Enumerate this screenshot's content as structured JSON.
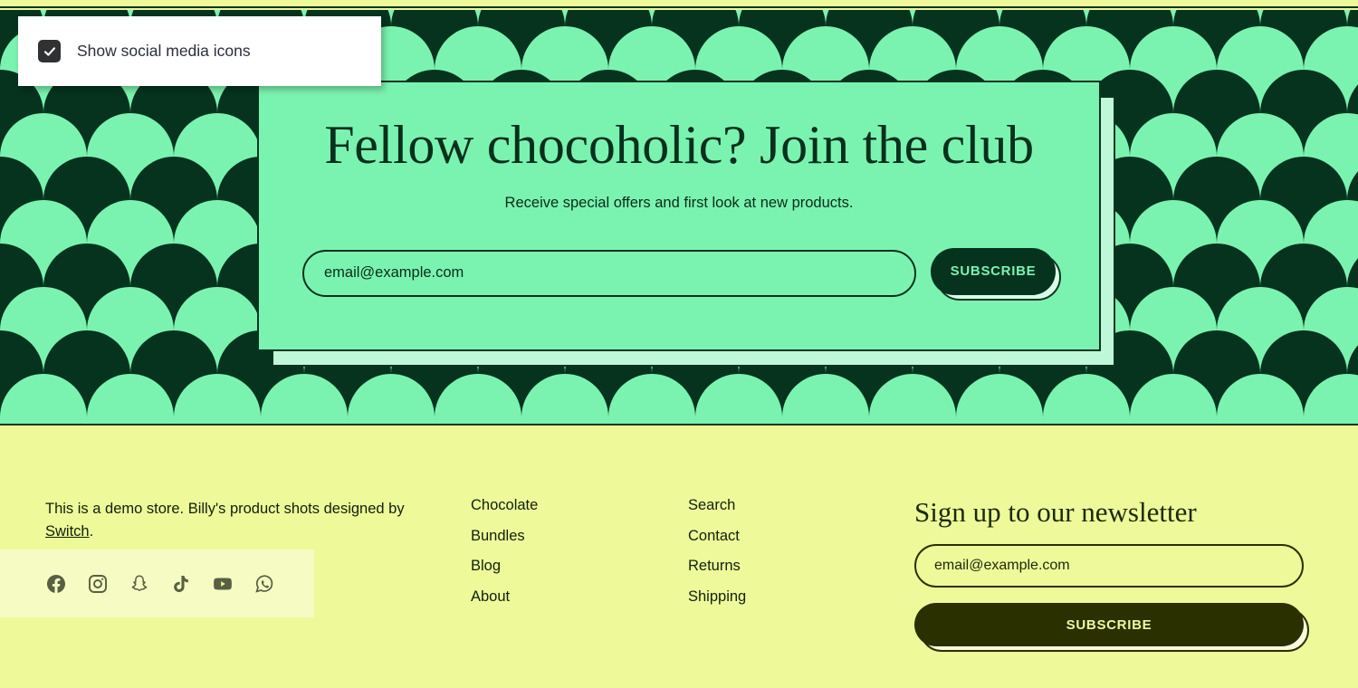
{
  "tooltip": {
    "label": "Show social media icons",
    "checked": true,
    "check_icon": "check-icon"
  },
  "hero": {
    "title": "Fellow chocoholic? Join the club",
    "subtitle": "Receive special offers and first look at new products.",
    "email_placeholder": "email@example.com",
    "email_value": "",
    "subscribe_label": "SUBSCRIBE"
  },
  "colors": {
    "mint": "#7BF3B0",
    "dark_green": "#05331E",
    "card_shadow": "#BFF8D8",
    "footer_yellow": "#EEF99A",
    "footer_dark": "#2B3000",
    "icon_gray": "#585F43"
  },
  "footer": {
    "about": {
      "text_before": "This is a demo store. Billy's product shots designed by ",
      "link_text": "Switch",
      "text_after": "."
    },
    "social": [
      {
        "name": "facebook-icon",
        "label": "Facebook"
      },
      {
        "name": "instagram-icon",
        "label": "Instagram"
      },
      {
        "name": "snapchat-icon",
        "label": "Snapchat"
      },
      {
        "name": "tiktok-icon",
        "label": "TikTok"
      },
      {
        "name": "youtube-icon",
        "label": "YouTube"
      },
      {
        "name": "whatsapp-icon",
        "label": "WhatsApp"
      }
    ],
    "links_col1": [
      "Chocolate",
      "Bundles",
      "Blog",
      "About"
    ],
    "links_col2": [
      "Search",
      "Contact",
      "Returns",
      "Shipping"
    ],
    "newsletter": {
      "title": "Sign up to our newsletter",
      "email_placeholder": "email@example.com",
      "email_value": "",
      "subscribe_label": "SUBSCRIBE"
    }
  },
  "pattern": {
    "type": "scallop-scales",
    "scale_size_px": 96,
    "rows": 10,
    "cols": 17
  }
}
